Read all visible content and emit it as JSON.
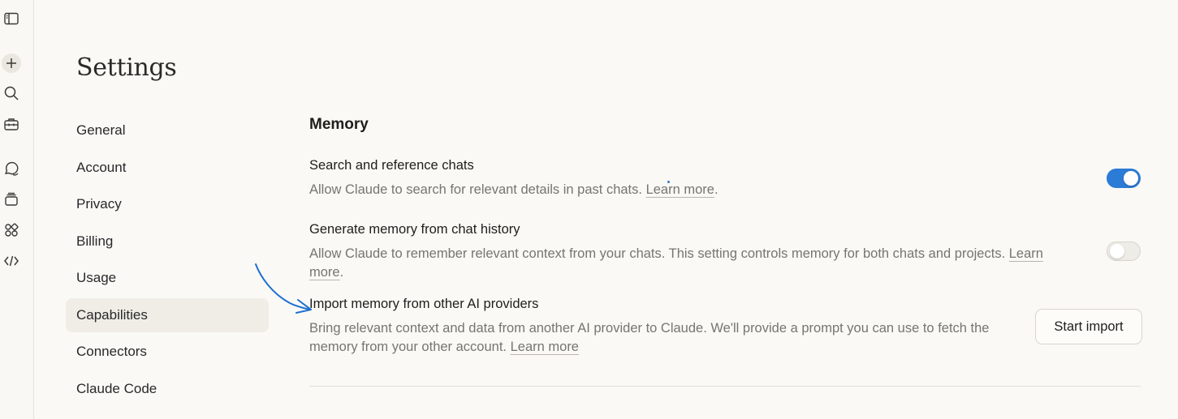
{
  "sidebar_rail": {
    "icons": [
      "sidebar-toggle-icon",
      "new-chat-icon",
      "search-icon",
      "toolbox-icon",
      "chats-icon",
      "projects-icon",
      "artifacts-icon",
      "code-icon"
    ]
  },
  "page": {
    "title": "Settings"
  },
  "nav": {
    "items": [
      {
        "label": "General"
      },
      {
        "label": "Account"
      },
      {
        "label": "Privacy"
      },
      {
        "label": "Billing"
      },
      {
        "label": "Usage"
      },
      {
        "label": "Capabilities"
      },
      {
        "label": "Connectors"
      },
      {
        "label": "Claude Code"
      }
    ],
    "active": "Capabilities"
  },
  "memory": {
    "section_title": "Memory",
    "settings": [
      {
        "title": "Search and reference chats",
        "description": "Allow Claude to search for relevant details in past chats.",
        "link": "Learn more",
        "suffix": ".",
        "enabled": true
      },
      {
        "title": "Generate memory from chat history",
        "description": "Allow Claude to remember relevant context from your chats. This setting controls memory for both chats and projects.",
        "link_line1": "Learn",
        "link_line2": "more",
        "suffix": ".",
        "enabled": false
      },
      {
        "title": "Import memory from other AI providers",
        "description_line1": "Bring relevant context and data from another AI provider to Claude. We'll provide a prompt you can use to fetch the",
        "description_line2": "memory from your other account.",
        "link": "Learn more",
        "button": "Start import"
      }
    ]
  },
  "colors": {
    "background": "#faf9f5",
    "toggle_on": "#2c7bd6",
    "annotation_arrow": "#1f6fd1"
  }
}
